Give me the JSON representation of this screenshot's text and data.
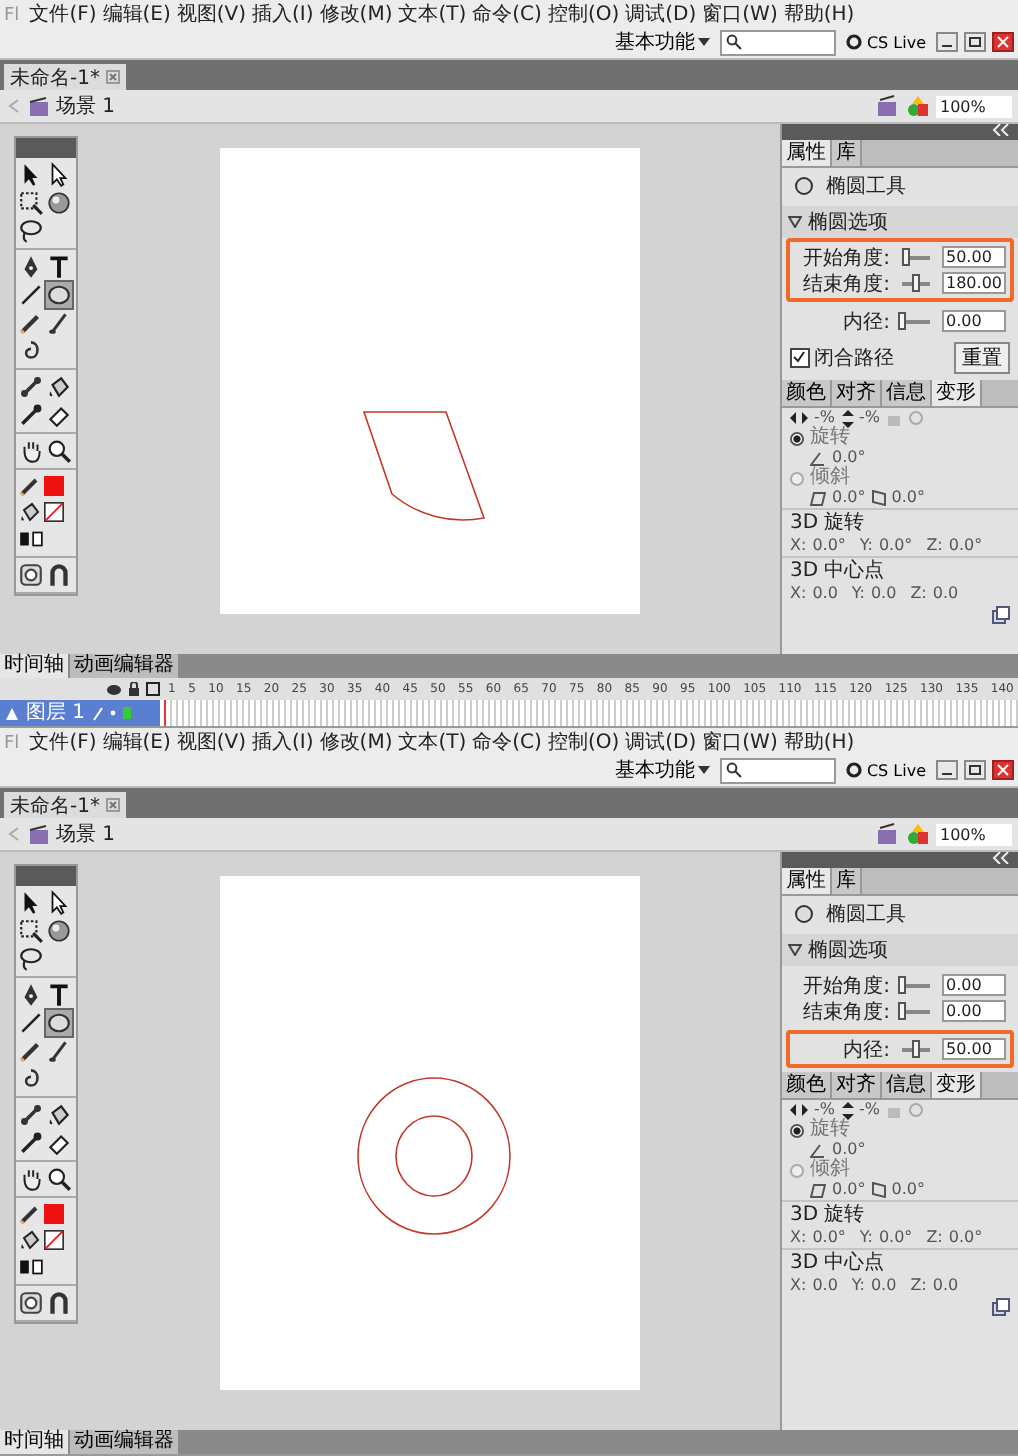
{
  "screens": [
    {
      "menu": {
        "logo": "Fl",
        "items": [
          "文件(F)",
          "编辑(E)",
          "视图(V)",
          "插入(I)",
          "修改(M)",
          "文本(T)",
          "命令(C)",
          "控制(O)",
          "调试(D)",
          "窗口(W)",
          "帮助(H)"
        ],
        "workspace": "基本功能",
        "cs_live": "CS Live"
      },
      "document_tab": "未命名-1*",
      "scene": "场景 1",
      "zoom": "100%",
      "tool_groups": [
        {
          "tools": [
            {
              "kind": "selection",
              "selected": false
            },
            {
              "kind": "subselection",
              "selected": false
            },
            {
              "kind": "free-transform",
              "selected": false
            },
            {
              "kind": "rotate-3d",
              "selected": false
            },
            {
              "kind": "lasso",
              "selected": false
            }
          ]
        },
        {
          "tools": [
            {
              "kind": "pen",
              "selected": false
            },
            {
              "kind": "text",
              "selected": false
            },
            {
              "kind": "line",
              "selected": false
            },
            {
              "kind": "oval",
              "selected": true
            },
            {
              "kind": "pencil",
              "selected": false
            },
            {
              "kind": "brush",
              "selected": false
            },
            {
              "kind": "deco",
              "selected": false
            }
          ]
        },
        {
          "tools": [
            {
              "kind": "bone",
              "selected": false
            },
            {
              "kind": "bucket",
              "selected": false
            },
            {
              "kind": "eyedropper",
              "selected": false
            },
            {
              "kind": "eraser",
              "selected": false
            }
          ]
        },
        {
          "tools": [
            {
              "kind": "hand",
              "selected": false
            },
            {
              "kind": "zoom",
              "selected": false
            }
          ]
        },
        {
          "tools": [
            {
              "kind": "stroke-color",
              "selected": false,
              "color": "#ee1111"
            },
            {
              "kind": "fill-color",
              "selected": false
            },
            {
              "kind": "swap-colors",
              "selected": false
            }
          ]
        },
        {
          "tools": [
            {
              "kind": "object-drawing",
              "selected": false
            },
            {
              "kind": "snap",
              "selected": false
            }
          ]
        }
      ],
      "stage": {
        "kind": "wedge"
      },
      "properties": {
        "tabs": [
          {
            "label": "属性",
            "selected": true
          },
          {
            "label": "库",
            "selected": false
          }
        ],
        "tool_name": "椭圆工具",
        "section": "椭圆选项",
        "option_groups": [
          {
            "highlighted": true,
            "options": [
              {
                "label": "开始角度:",
                "level": 0.15,
                "value": "50.00"
              },
              {
                "label": "结束角度:",
                "level": 0.5,
                "value": "180.00"
              }
            ]
          },
          {
            "highlighted": false,
            "options": [
              {
                "label": "内径:",
                "level": 0.0,
                "value": "0.00"
              }
            ]
          }
        ],
        "closed_path": {
          "label": "闭合路径",
          "checked": true
        },
        "reset": "重置"
      },
      "transform": {
        "tabs": [
          {
            "label": "颜色",
            "selected": false
          },
          {
            "label": "对齐",
            "selected": false
          },
          {
            "label": "信息",
            "selected": false
          },
          {
            "label": "变形",
            "selected": true
          }
        ],
        "scale": [
          "-%",
          "-%"
        ],
        "rotate": {
          "label": "旋转",
          "selected": true,
          "angle": "0.0°"
        },
        "skew": {
          "label": "倾斜",
          "selected": false,
          "values": [
            "0.0°",
            "0.0°"
          ]
        },
        "groups": [
          {
            "title": "3D 旋转",
            "fields": [
              {
                "axis": "X:",
                "value": "0.0°"
              },
              {
                "axis": "Y:",
                "value": "0.0°"
              },
              {
                "axis": "Z:",
                "value": "0.0°"
              }
            ]
          },
          {
            "title": "3D 中心点",
            "fields": [
              {
                "axis": "X:",
                "value": "0.0"
              },
              {
                "axis": "Y:",
                "value": "0.0"
              },
              {
                "axis": "Z:",
                "value": "0.0"
              }
            ]
          }
        ]
      },
      "timeline": {
        "tabs": [
          {
            "label": "时间轴",
            "selected": true
          },
          {
            "label": "动画编辑器",
            "selected": false
          }
        ],
        "frames": [
          "1",
          "5",
          "10",
          "15",
          "20",
          "25",
          "30",
          "35",
          "40",
          "45",
          "50",
          "55",
          "60",
          "65",
          "70",
          "75",
          "80",
          "85",
          "90",
          "95",
          "100",
          "105",
          "110",
          "115",
          "120",
          "125",
          "130",
          "135",
          "140"
        ],
        "layers": [
          {
            "name": "图层 1",
            "selected": true
          }
        ]
      }
    },
    {
      "menu": {
        "logo": "Fl",
        "items": [
          "文件(F)",
          "编辑(E)",
          "视图(V)",
          "插入(I)",
          "修改(M)",
          "文本(T)",
          "命令(C)",
          "控制(O)",
          "调试(D)",
          "窗口(W)",
          "帮助(H)"
        ],
        "workspace": "基本功能",
        "cs_live": "CS Live"
      },
      "document_tab": "未命名-1*",
      "scene": "场景 1",
      "zoom": "100%",
      "tool_groups": [
        {
          "tools": [
            {
              "kind": "selection",
              "selected": false
            },
            {
              "kind": "subselection",
              "selected": false
            },
            {
              "kind": "free-transform",
              "selected": false
            },
            {
              "kind": "rotate-3d",
              "selected": false
            },
            {
              "kind": "lasso",
              "selected": false
            }
          ]
        },
        {
          "tools": [
            {
              "kind": "pen",
              "selected": false
            },
            {
              "kind": "text",
              "selected": false
            },
            {
              "kind": "line",
              "selected": false
            },
            {
              "kind": "oval",
              "selected": true
            },
            {
              "kind": "pencil",
              "selected": false
            },
            {
              "kind": "brush",
              "selected": false
            },
            {
              "kind": "deco",
              "selected": false
            }
          ]
        },
        {
          "tools": [
            {
              "kind": "bone",
              "selected": false
            },
            {
              "kind": "bucket",
              "selected": false
            },
            {
              "kind": "eyedropper",
              "selected": false
            },
            {
              "kind": "eraser",
              "selected": false
            }
          ]
        },
        {
          "tools": [
            {
              "kind": "hand",
              "selected": false
            },
            {
              "kind": "zoom",
              "selected": false
            }
          ]
        },
        {
          "tools": [
            {
              "kind": "stroke-color",
              "selected": false,
              "color": "#ee1111"
            },
            {
              "kind": "fill-color",
              "selected": false
            },
            {
              "kind": "swap-colors",
              "selected": false
            }
          ]
        },
        {
          "tools": [
            {
              "kind": "object-drawing",
              "selected": false
            },
            {
              "kind": "snap",
              "selected": false
            }
          ]
        }
      ],
      "stage": {
        "kind": "ring"
      },
      "properties": {
        "tabs": [
          {
            "label": "属性",
            "selected": true
          },
          {
            "label": "库",
            "selected": false
          }
        ],
        "tool_name": "椭圆工具",
        "section": "椭圆选项",
        "option_groups": [
          {
            "highlighted": false,
            "options": [
              {
                "label": "开始角度:",
                "level": 0.0,
                "value": "0.00"
              },
              {
                "label": "结束角度:",
                "level": 0.0,
                "value": "0.00"
              }
            ]
          },
          {
            "highlighted": true,
            "options": [
              {
                "label": "内径:",
                "level": 0.5,
                "value": "50.00"
              }
            ]
          }
        ]
      },
      "transform": {
        "tabs": [
          {
            "label": "颜色",
            "selected": false
          },
          {
            "label": "对齐",
            "selected": false
          },
          {
            "label": "信息",
            "selected": false
          },
          {
            "label": "变形",
            "selected": true
          }
        ],
        "scale": [
          "-%",
          "-%"
        ],
        "rotate": {
          "label": "旋转",
          "selected": true,
          "angle": "0.0°"
        },
        "skew": {
          "label": "倾斜",
          "selected": false,
          "values": [
            "0.0°",
            "0.0°"
          ]
        },
        "groups": [
          {
            "title": "3D 旋转",
            "fields": [
              {
                "axis": "X:",
                "value": "0.0°"
              },
              {
                "axis": "Y:",
                "value": "0.0°"
              },
              {
                "axis": "Z:",
                "value": "0.0°"
              }
            ]
          },
          {
            "title": "3D 中心点",
            "fields": [
              {
                "axis": "X:",
                "value": "0.0"
              },
              {
                "axis": "Y:",
                "value": "0.0"
              },
              {
                "axis": "Z:",
                "value": "0.0"
              }
            ]
          }
        ]
      },
      "timeline": {
        "tabs": [
          {
            "label": "时间轴",
            "selected": true
          },
          {
            "label": "动画编辑器",
            "selected": false
          }
        ]
      }
    }
  ]
}
